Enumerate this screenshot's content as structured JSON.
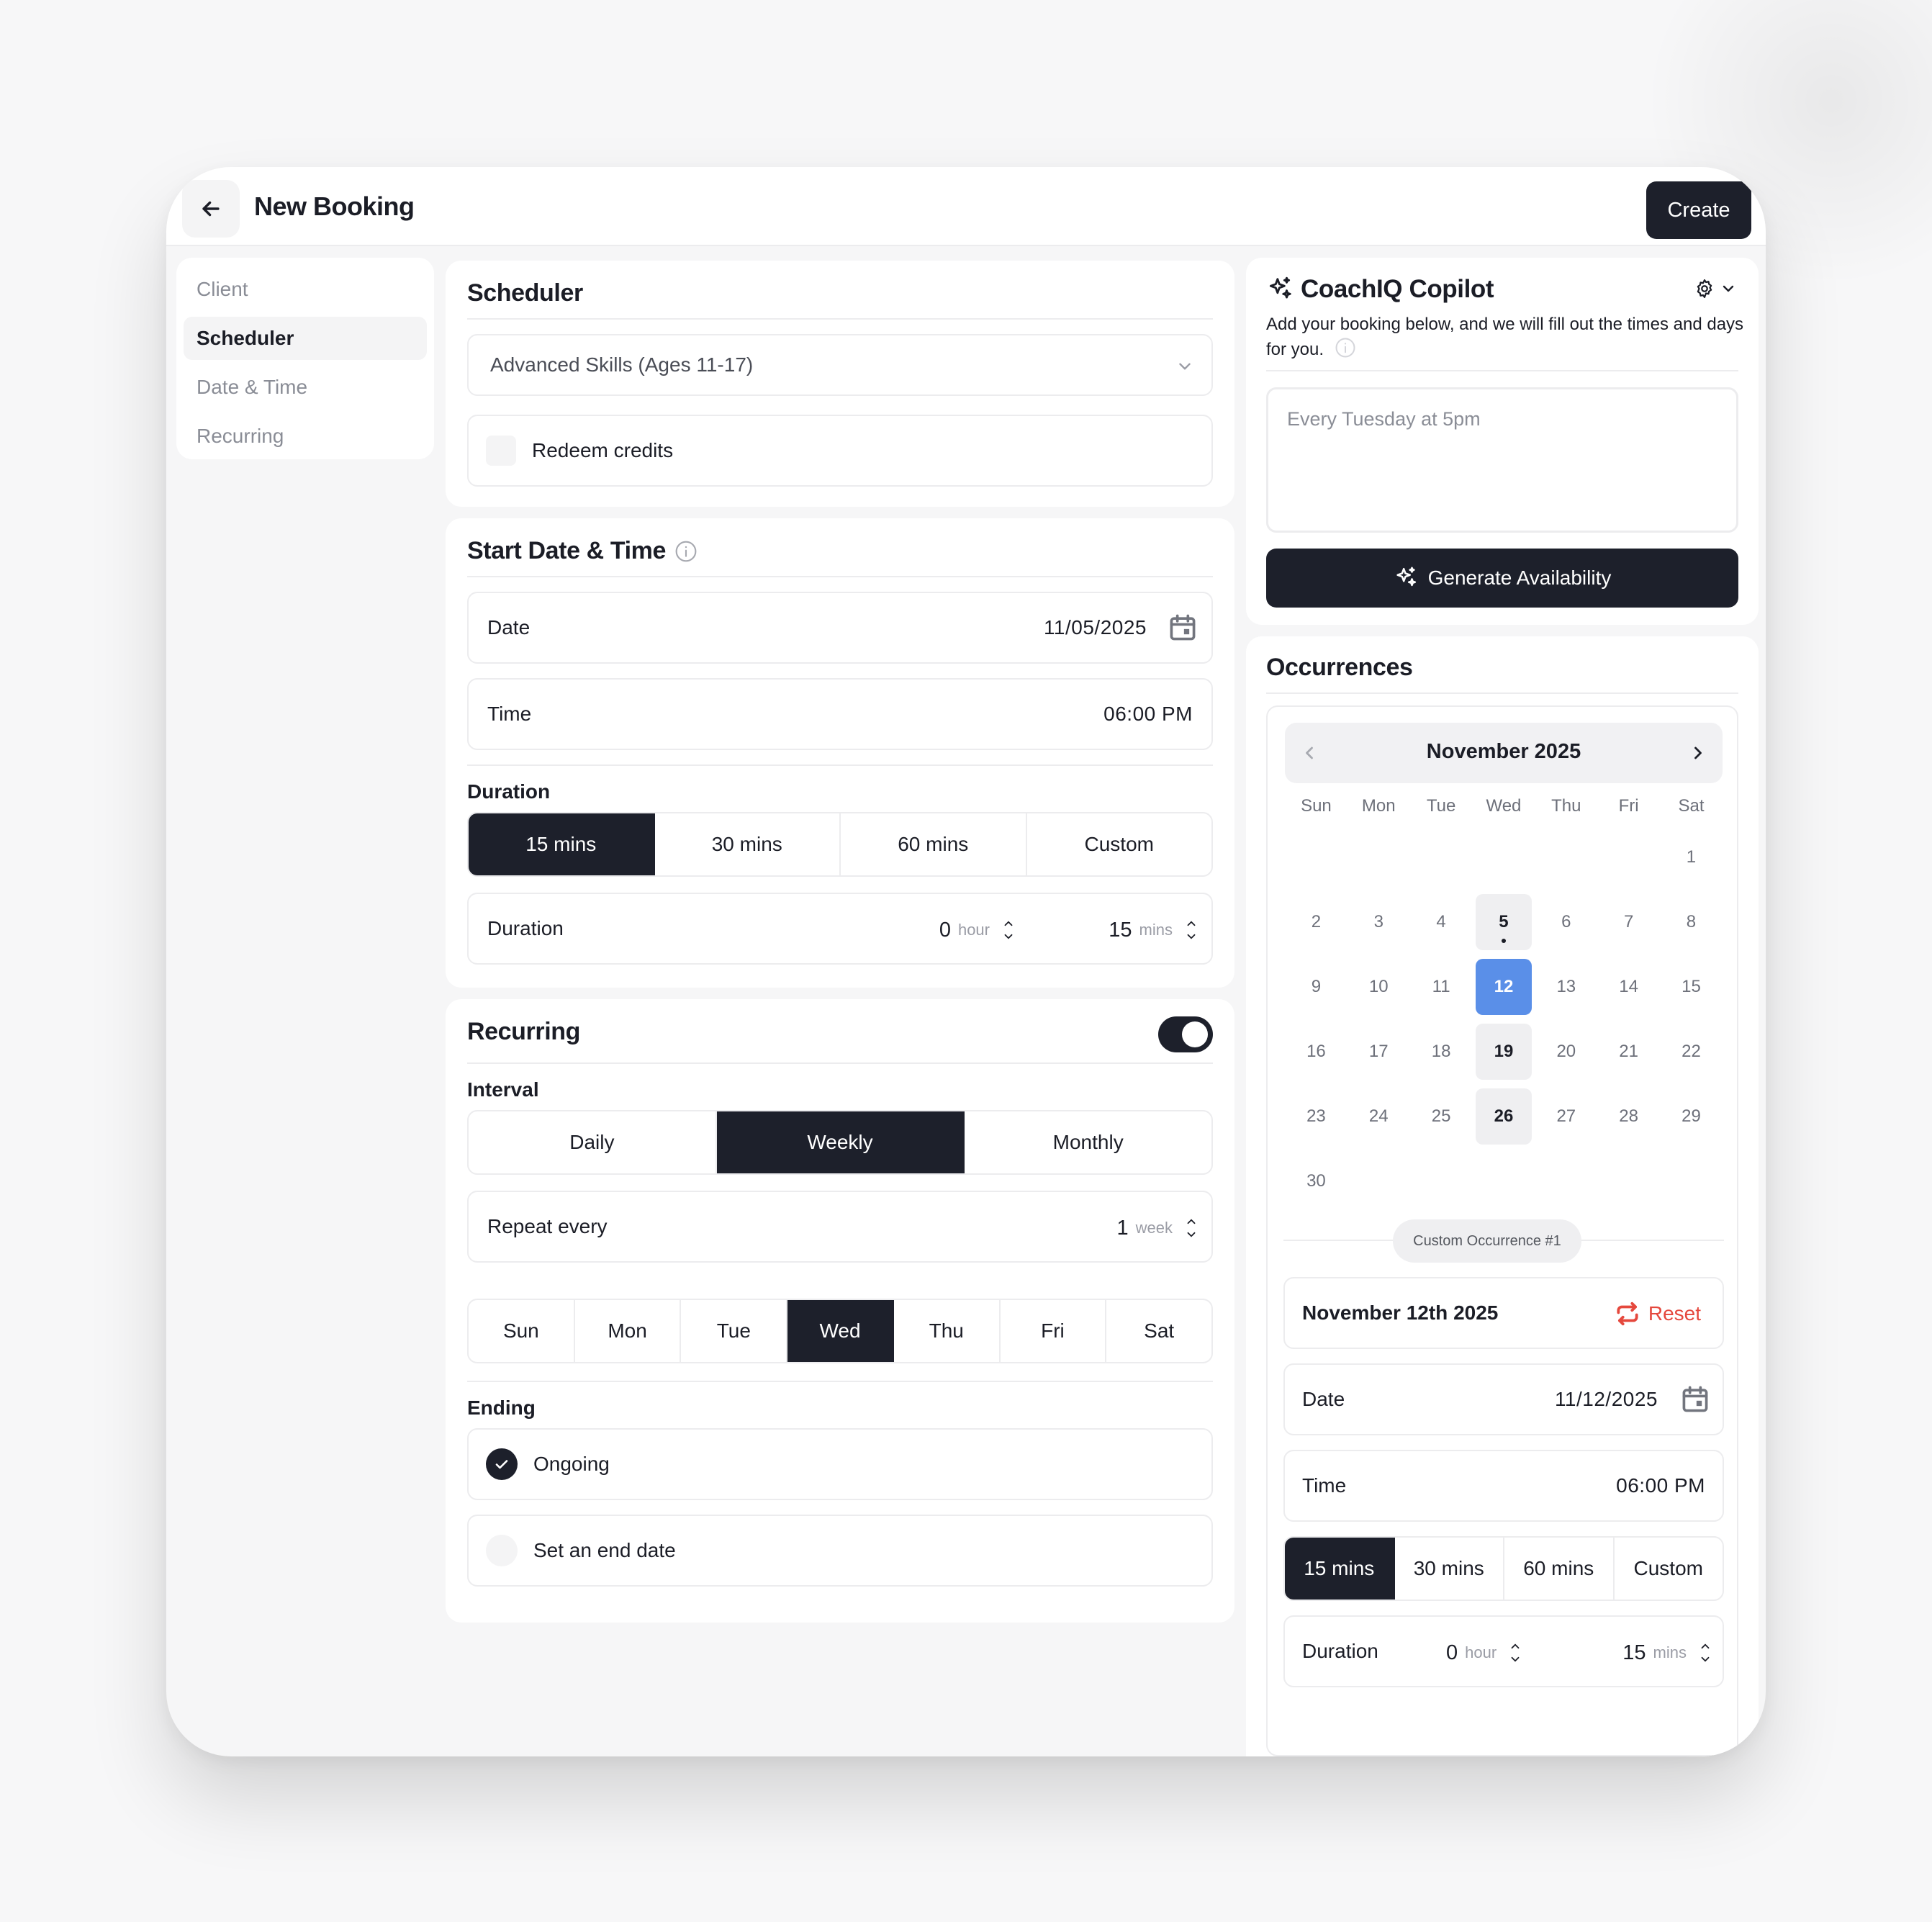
{
  "header": {
    "title": "New Booking",
    "create_label": "Create"
  },
  "sidebar": {
    "items": [
      {
        "label": "Client"
      },
      {
        "label": "Scheduler"
      },
      {
        "label": "Date & Time"
      },
      {
        "label": "Recurring"
      }
    ]
  },
  "scheduler": {
    "title": "Scheduler",
    "program_value": "Advanced Skills (Ages 11-17)",
    "redeem_label": "Redeem credits"
  },
  "start": {
    "title": "Start Date & Time",
    "date_label": "Date",
    "date_value": "11/05/2025",
    "time_label": "Time",
    "time_value": "06:00 PM",
    "duration_title": "Duration",
    "duration_options": [
      "15 mins",
      "30 mins",
      "60 mins",
      "Custom"
    ],
    "duration_selected": "15 mins",
    "duration_label": "Duration",
    "hours_value": "0",
    "hours_unit": "hour",
    "mins_value": "15",
    "mins_unit": "mins"
  },
  "recurring": {
    "title": "Recurring",
    "enabled": true,
    "interval_title": "Interval",
    "interval_options": [
      "Daily",
      "Weekly",
      "Monthly"
    ],
    "interval_selected": "Weekly",
    "repeat_label": "Repeat every",
    "repeat_value": "1",
    "repeat_unit": "week",
    "days": [
      "Sun",
      "Mon",
      "Tue",
      "Wed",
      "Thu",
      "Fri",
      "Sat"
    ],
    "day_selected": "Wed",
    "ending_title": "Ending",
    "ending_ongoing": "Ongoing",
    "ending_end_date": "Set an end date"
  },
  "copilot": {
    "title": "CoachIQ Copilot",
    "description": "Add your booking below, and we will fill out the times and days for you.",
    "input_placeholder": "Every Tuesday at 5pm",
    "generate_label": "Generate Availability"
  },
  "occurrences": {
    "title": "Occurrences",
    "month_label": "November 2025",
    "weekdays": [
      "Sun",
      "Mon",
      "Tue",
      "Wed",
      "Thu",
      "Fri",
      "Sat"
    ],
    "weeks": [
      [
        "",
        "",
        "",
        "",
        "",
        "",
        "1"
      ],
      [
        "2",
        "3",
        "4",
        "5",
        "6",
        "7",
        "8"
      ],
      [
        "9",
        "10",
        "11",
        "12",
        "13",
        "14",
        "15"
      ],
      [
        "16",
        "17",
        "18",
        "19",
        "20",
        "21",
        "22"
      ],
      [
        "23",
        "24",
        "25",
        "26",
        "27",
        "28",
        "29"
      ],
      [
        "30",
        "",
        "",
        "",
        "",
        "",
        ""
      ]
    ],
    "highlighted_days": [
      "5",
      "19",
      "26"
    ],
    "selected_day": "12",
    "today_marker_day": "5",
    "custom_badge": "Custom Occurrence #1",
    "custom_date_heading": "November 12th 2025",
    "reset_label": "Reset",
    "date_label": "Date",
    "date_value": "11/12/2025",
    "time_label": "Time",
    "time_value": "06:00 PM",
    "duration_options": [
      "15 mins",
      "30 mins",
      "60 mins",
      "Custom"
    ],
    "duration_selected": "15 mins",
    "duration_label": "Duration",
    "hours_value": "0",
    "hours_unit": "hour",
    "mins_value": "15",
    "mins_unit": "mins"
  },
  "colors": {
    "primary": "#1d202b",
    "accent_blue": "#5a8fe8",
    "reset_red": "#e5483d"
  }
}
